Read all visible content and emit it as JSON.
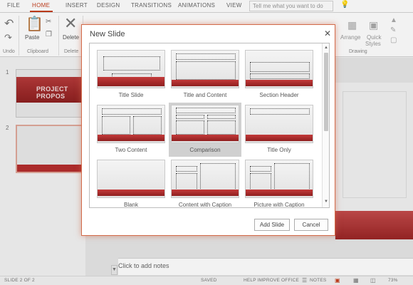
{
  "ribbon": {
    "tabs": [
      "FILE",
      "HOME",
      "INSERT",
      "DESIGN",
      "TRANSITIONS",
      "ANIMATIONS",
      "VIEW"
    ],
    "active_tab": "HOME",
    "tell_me_placeholder": "Tell me what you want to do",
    "groups": {
      "undo": "Undo",
      "clipboard": "Clipboard",
      "delete": "Delete",
      "drawing": "Drawing"
    },
    "buttons": {
      "paste": "Paste",
      "delete": "Delete",
      "arrange": "Arrange",
      "quick_styles_1": "Quick",
      "quick_styles_2": "Styles"
    }
  },
  "thumbnails": [
    {
      "number": "1",
      "text": "PROJECT PROPOS"
    },
    {
      "number": "2",
      "text": ""
    }
  ],
  "notes_placeholder": "Click to add notes",
  "status": {
    "slide": "SLIDE 2 OF 2",
    "saved": "SAVED",
    "help": "HELP IMPROVE OFFICE",
    "notes": "NOTES",
    "zoom": "73%"
  },
  "dialog": {
    "title": "New Slide",
    "layouts": [
      "Title Slide",
      "Title and Content",
      "Section Header",
      "Two Content",
      "Comparison",
      "Title Only",
      "Blank",
      "Content with Caption",
      "Picture with Caption"
    ],
    "selected_layout": "Comparison",
    "add_button": "Add Slide",
    "cancel_button": "Cancel"
  },
  "colors": {
    "accent": "#c43e1c",
    "theme_red": "#b52e2e",
    "dialog_border": "#d36b4a"
  },
  "icons": [
    "undo-icon",
    "redo-icon",
    "paste-icon",
    "delete-icon",
    "close-icon",
    "lightbulb-icon"
  ]
}
